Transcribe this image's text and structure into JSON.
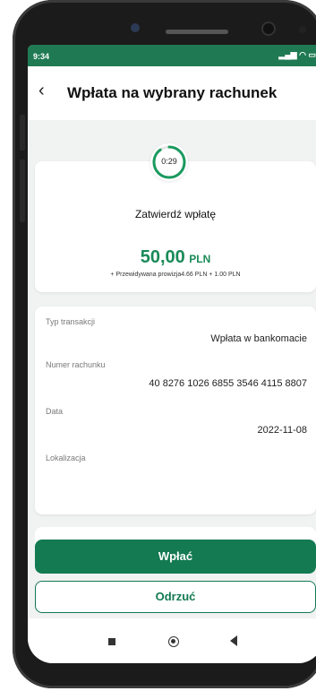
{
  "status": {
    "time": "9:34",
    "icons": "signal wifi battery"
  },
  "header": {
    "back_icon": "chevron-left-icon",
    "title": "Wpłata na wybrany rachunek"
  },
  "timer": {
    "value": "0:29",
    "progress_fraction": 0.9
  },
  "confirm": {
    "heading": "Zatwierdź wpłatę",
    "amount_whole": "50",
    "amount_decimal": ",00",
    "currency": "PLN",
    "fee": "+ Przewidywana prowizja4.66 PLN + 1.00 PLN"
  },
  "details": {
    "type_label": "Typ transakcji",
    "type_value": "Wpłata w bankomacie",
    "account_label": "Numer rachunku",
    "account_value": "40 8276 1026 6855 3546 4115 8807",
    "date_label": "Data",
    "date_value": "2022-11-08",
    "location_label": "Lokalizacja",
    "location_value": ""
  },
  "actions": {
    "deposit": "Wpłać",
    "reject": "Odrzuć"
  },
  "colors": {
    "brand": "#137a52",
    "accent": "#1a8a57"
  }
}
